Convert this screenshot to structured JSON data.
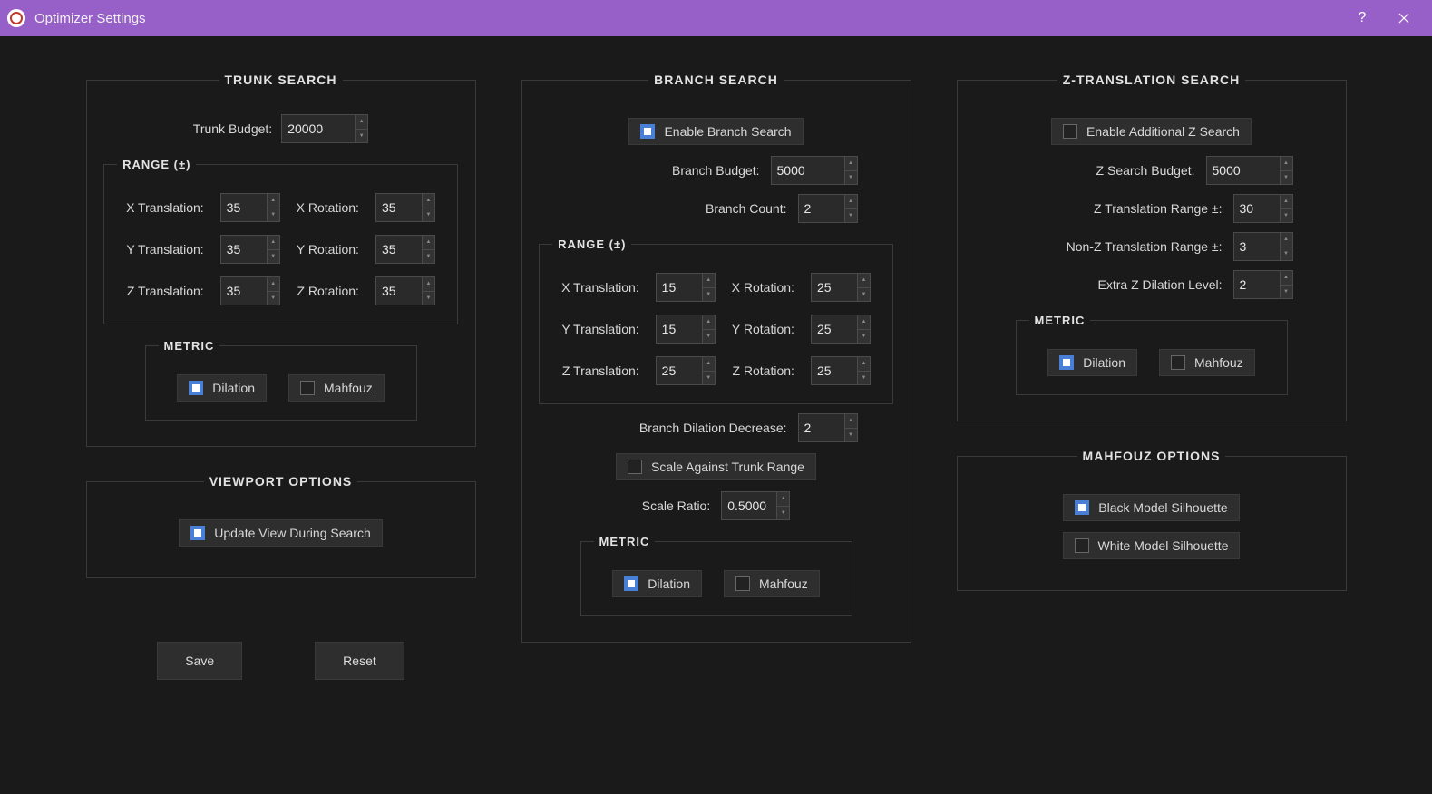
{
  "window": {
    "title": "Optimizer Settings"
  },
  "trunk": {
    "title": "TRUNK SEARCH",
    "budget_label": "Trunk Budget:",
    "budget": "20000",
    "range_title": "RANGE (±)",
    "x_trans_label": "X Translation:",
    "x_trans": "35",
    "y_trans_label": "Y Translation:",
    "y_trans": "35",
    "z_trans_label": "Z Translation:",
    "z_trans": "35",
    "x_rot_label": "X Rotation:",
    "x_rot": "35",
    "y_rot_label": "Y Rotation:",
    "y_rot": "35",
    "z_rot_label": "Z Rotation:",
    "z_rot": "35",
    "metric_title": "METRIC",
    "dilation_label": "Dilation",
    "mahfouz_label": "Mahfouz",
    "dilation_checked": true,
    "mahfouz_checked": false
  },
  "viewport": {
    "title": "VIEWPORT OPTIONS",
    "update_label": "Update View During Search",
    "update_checked": true
  },
  "buttons": {
    "save": "Save",
    "reset": "Reset"
  },
  "branch": {
    "title": "BRANCH SEARCH",
    "enable_label": "Enable Branch Search",
    "enable_checked": true,
    "budget_label": "Branch Budget:",
    "budget": "5000",
    "count_label": "Branch Count:",
    "count": "2",
    "range_title": "RANGE (±)",
    "x_trans_label": "X Translation:",
    "x_trans": "15",
    "y_trans_label": "Y Translation:",
    "y_trans": "15",
    "z_trans_label": "Z Translation:",
    "z_trans": "25",
    "x_rot_label": "X Rotation:",
    "x_rot": "25",
    "y_rot_label": "Y Rotation:",
    "y_rot": "25",
    "z_rot_label": "Z Rotation:",
    "z_rot": "25",
    "dilation_decrease_label": "Branch Dilation Decrease:",
    "dilation_decrease": "2",
    "scale_against_label": "Scale Against Trunk Range",
    "scale_against_checked": false,
    "scale_ratio_label": "Scale Ratio:",
    "scale_ratio": "0.5000",
    "metric_title": "METRIC",
    "dilation_label": "Dilation",
    "dilation_checked": true,
    "mahfouz_label": "Mahfouz",
    "mahfouz_checked": false
  },
  "zsearch": {
    "title": "Z-TRANSLATION SEARCH",
    "enable_label": "Enable Additional Z Search",
    "enable_checked": false,
    "budget_label": "Z Search Budget:",
    "budget": "5000",
    "z_range_label": "Z Translation Range ±:",
    "z_range": "30",
    "nonz_range_label": "Non-Z Translation Range ±:",
    "nonz_range": "3",
    "extra_dilation_label": "Extra Z Dilation Level:",
    "extra_dilation": "2",
    "metric_title": "METRIC",
    "dilation_label": "Dilation",
    "dilation_checked": true,
    "mahfouz_label": "Mahfouz",
    "mahfouz_checked": false
  },
  "mahfouz_opts": {
    "title": "MAHFOUZ OPTIONS",
    "black_label": "Black Model Silhouette",
    "black_checked": true,
    "white_label": "White Model Silhouette",
    "white_checked": false
  }
}
